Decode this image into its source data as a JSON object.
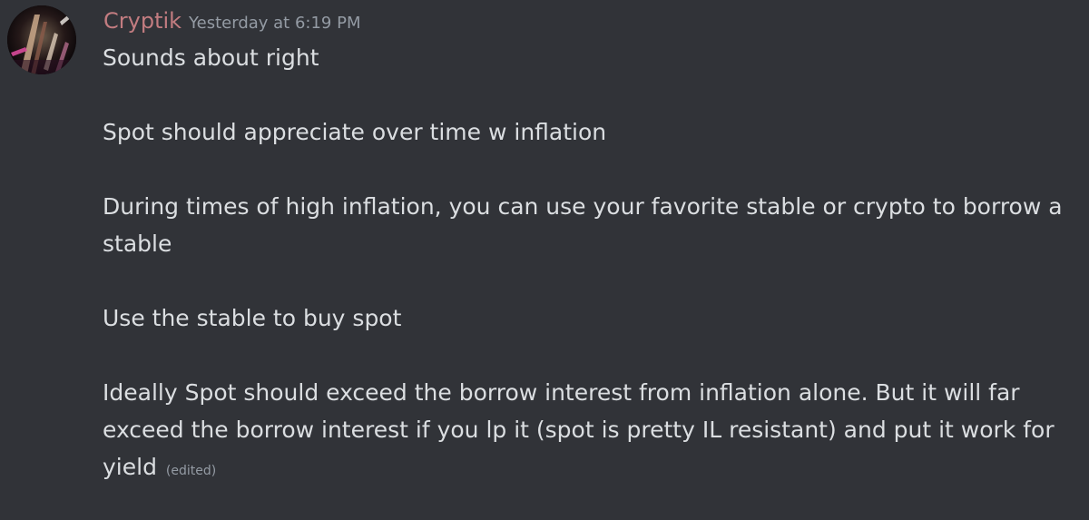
{
  "message": {
    "author": "Cryptik",
    "timestamp": "Yesterday at 6:19 PM",
    "author_color": "#c27c80",
    "avatar_icon": "user-avatar",
    "paragraphs": [
      "Sounds about right",
      "Spot should appreciate over time w inflation",
      "During times of high  inflation, you can use your favorite stable or crypto to borrow a stable",
      "Use the stable to buy spot",
      "Ideally Spot should exceed the borrow interest from inflation alone. But it will far exceed the borrow interest if you lp it (spot is pretty IL resistant) and put it work for yield"
    ],
    "edited_label": "(edited)"
  }
}
